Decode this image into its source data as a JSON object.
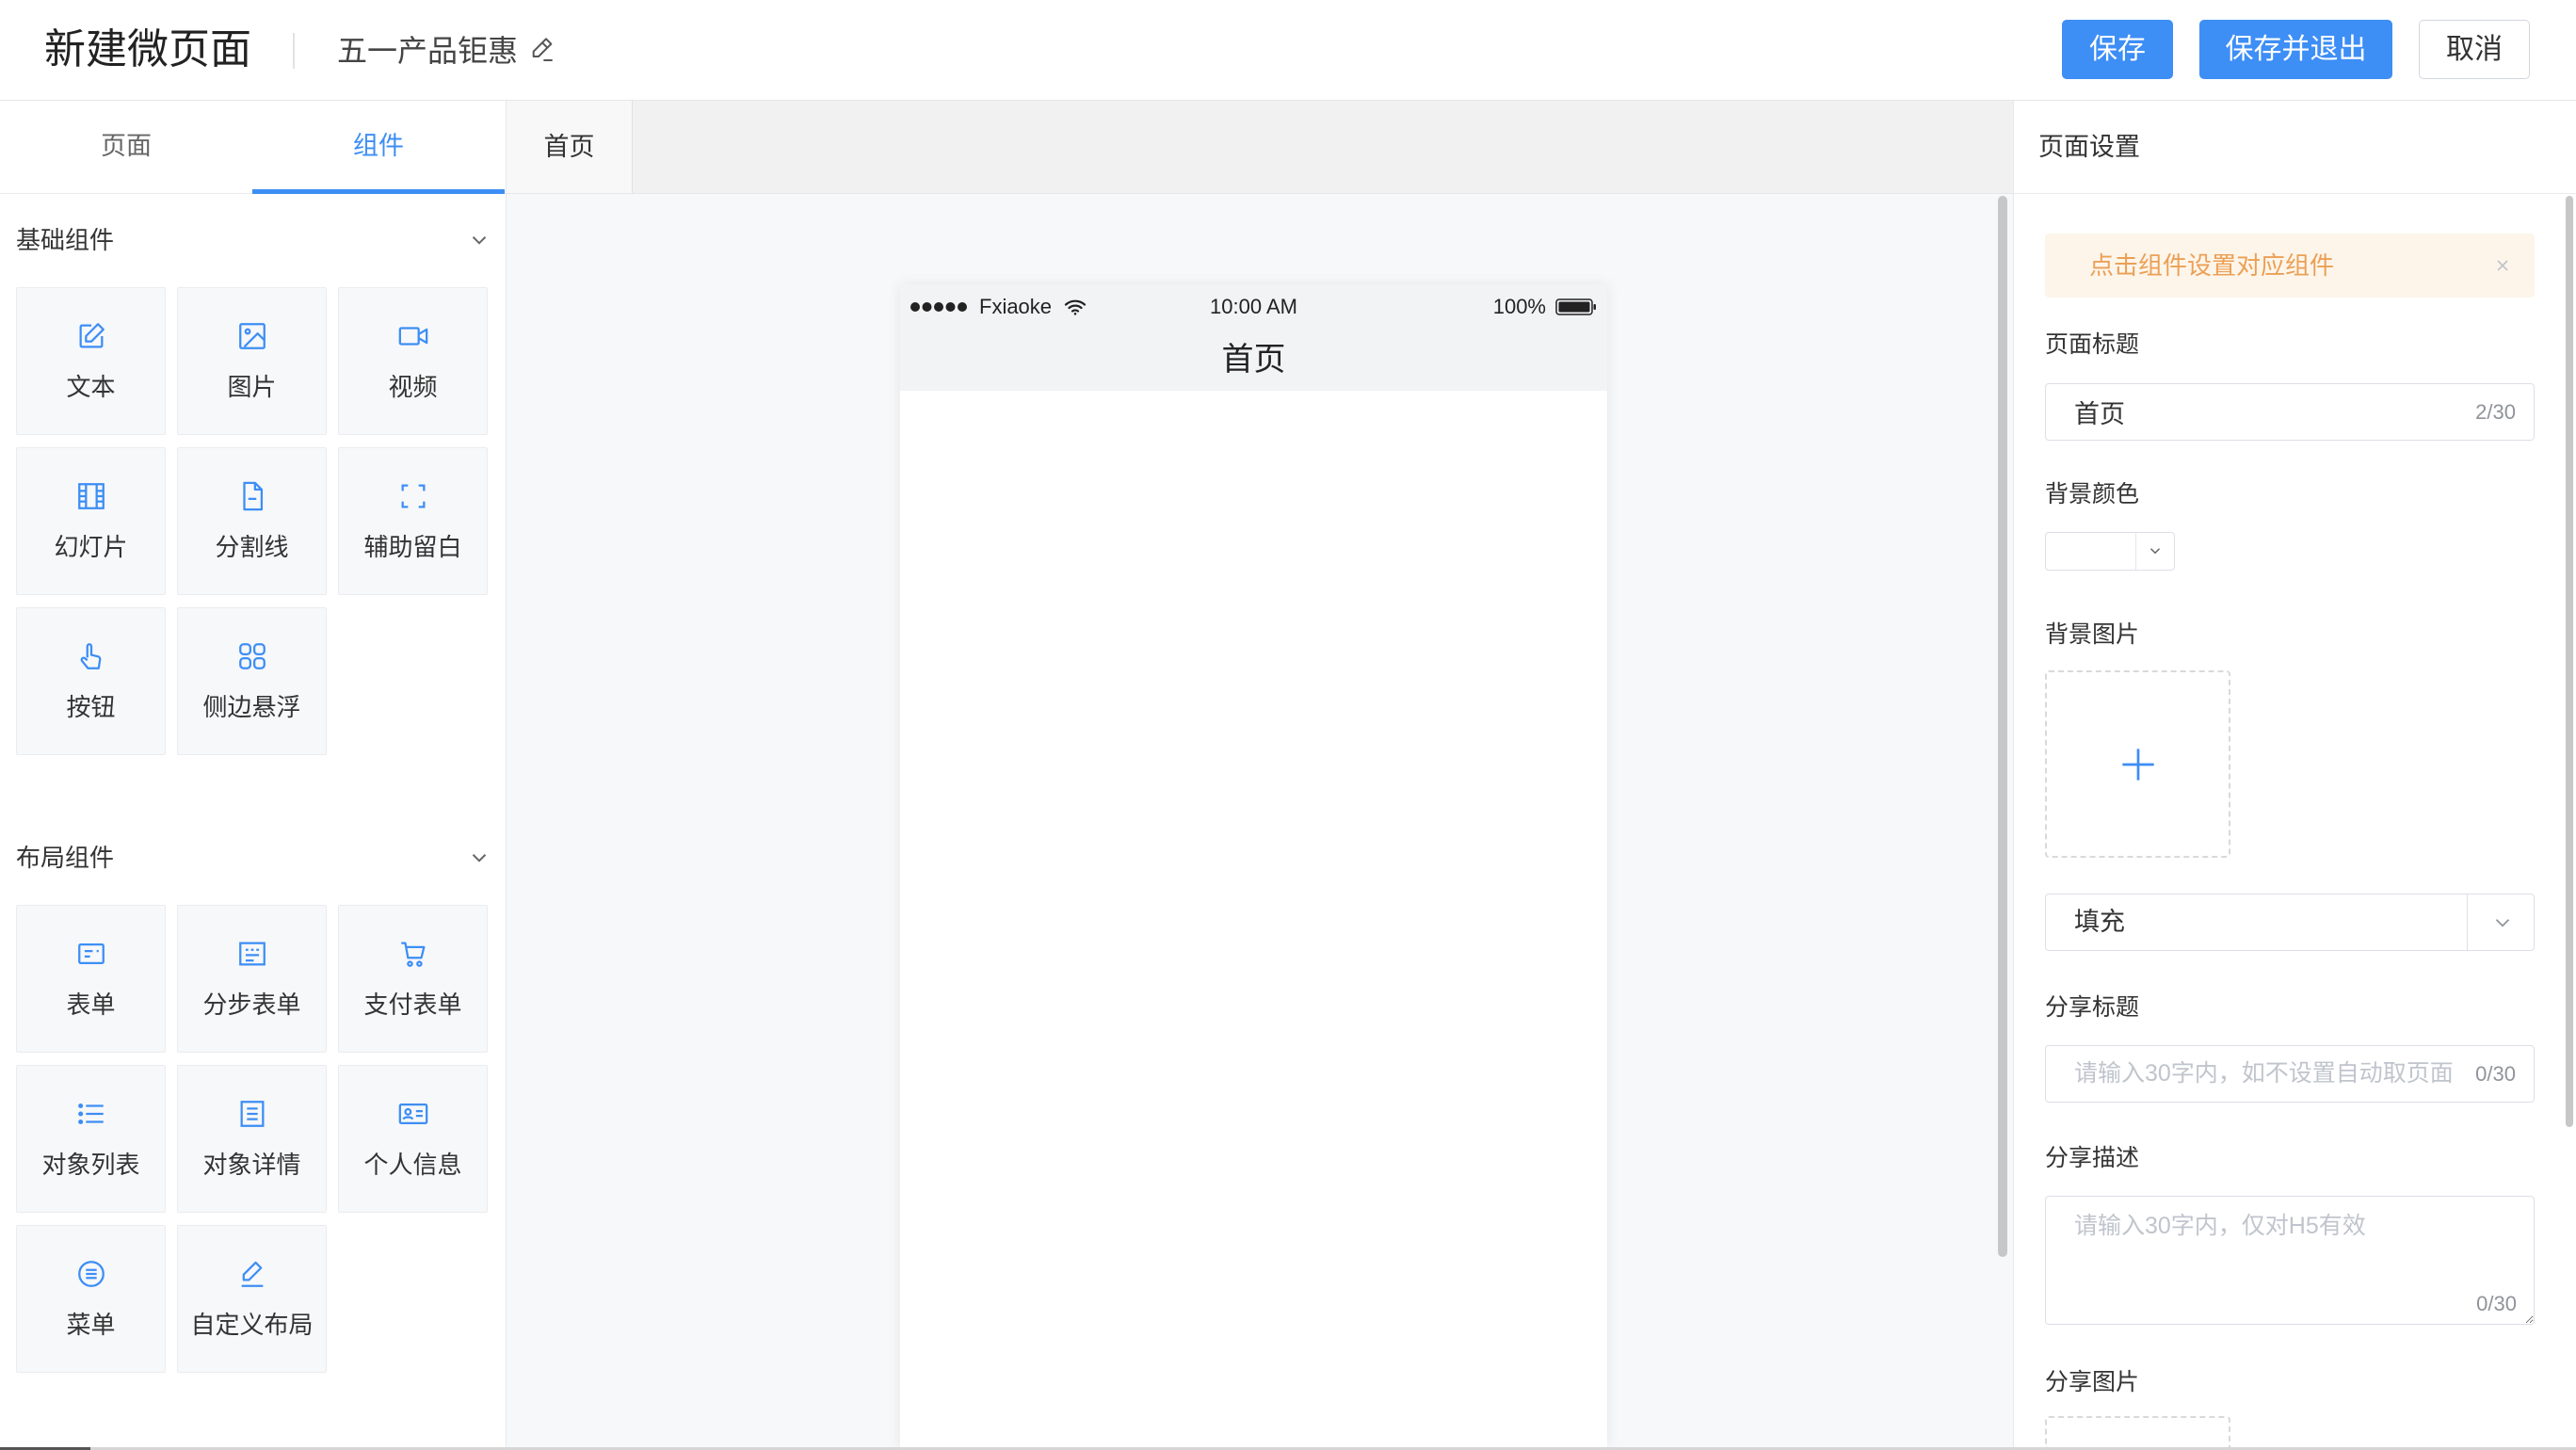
{
  "header": {
    "title": "新建微页面",
    "page_name": "五一产品钜惠",
    "edit_icon": "edit-icon",
    "buttons": {
      "save": "保存",
      "save_exit": "保存并退出",
      "cancel": "取消"
    }
  },
  "left_panel": {
    "tabs": [
      {
        "label": "页面",
        "active": false
      },
      {
        "label": "组件",
        "active": true
      }
    ],
    "sections": [
      {
        "title": "基础组件",
        "expanded": true,
        "items": [
          {
            "label": "文本",
            "icon": "text-edit-icon"
          },
          {
            "label": "图片",
            "icon": "image-icon"
          },
          {
            "label": "视频",
            "icon": "video-icon"
          },
          {
            "label": "幻灯片",
            "icon": "slides-icon"
          },
          {
            "label": "分割线",
            "icon": "divider-icon"
          },
          {
            "label": "辅助留白",
            "icon": "spacing-icon"
          },
          {
            "label": "按钮",
            "icon": "hand-pointer-icon"
          },
          {
            "label": "侧边悬浮",
            "icon": "float-grid-icon"
          }
        ]
      },
      {
        "title": "布局组件",
        "expanded": true,
        "items": [
          {
            "label": "表单",
            "icon": "form-icon"
          },
          {
            "label": "分步表单",
            "icon": "step-form-icon"
          },
          {
            "label": "支付表单",
            "icon": "cart-icon"
          },
          {
            "label": "对象列表",
            "icon": "list-icon"
          },
          {
            "label": "对象详情",
            "icon": "detail-icon"
          },
          {
            "label": "个人信息",
            "icon": "id-card-icon"
          },
          {
            "label": "菜单",
            "icon": "menu-icon"
          },
          {
            "label": "自定义布局",
            "icon": "custom-layout-icon"
          }
        ]
      }
    ]
  },
  "canvas": {
    "tabs": [
      {
        "label": "首页",
        "active": true
      }
    ],
    "phone": {
      "signal_icon": "signal-dots-icon",
      "carrier": "Fxiaoke",
      "wifi_icon": "wifi-icon",
      "time": "10:00 AM",
      "battery": "100%",
      "battery_icon": "battery-icon",
      "title": "首页"
    }
  },
  "settings": {
    "title": "页面设置",
    "alert": "点击组件设置对应组件",
    "page_title": {
      "label": "页面标题",
      "value": "首页",
      "counter": "2/30"
    },
    "bg_color": {
      "label": "背景颜色",
      "value": "#ffffff"
    },
    "bg_image": {
      "label": "背景图片",
      "icon": "plus-icon"
    },
    "fill_select": {
      "value": "填充"
    },
    "share_title": {
      "label": "分享标题",
      "placeholder": "请输入30字内，如不设置自动取页面",
      "counter": "0/30"
    },
    "share_desc": {
      "label": "分享描述",
      "placeholder": "请输入30字内，仅对H5有效",
      "counter": "0/30"
    },
    "share_image": {
      "label": "分享图片"
    }
  },
  "colors": {
    "accent": "#3d8ef5",
    "alert_bg": "#fdf5ea",
    "alert_text": "#eba055",
    "canvas_bg": "#f7f8fa"
  }
}
